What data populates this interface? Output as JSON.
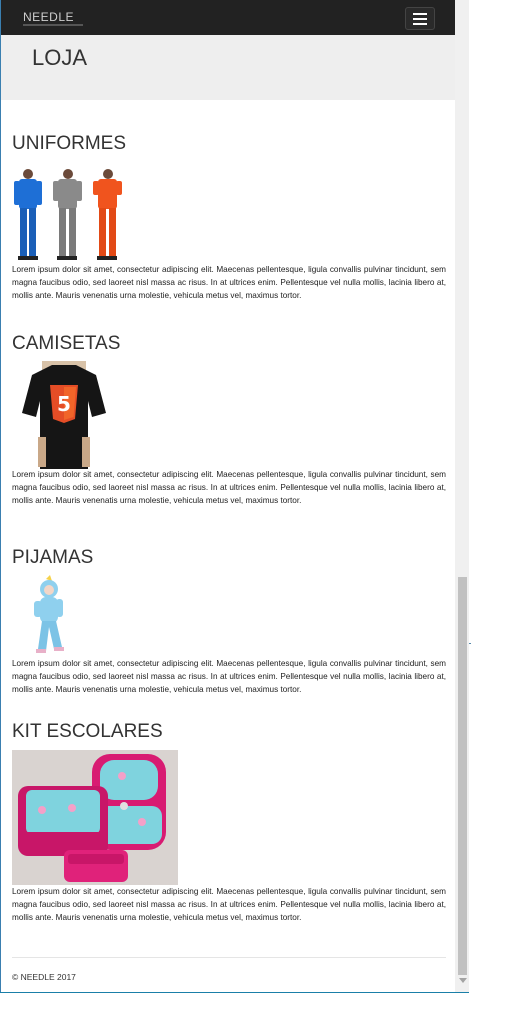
{
  "navbar": {
    "brand": "NEEDLE"
  },
  "hero": {
    "title": "LOJA"
  },
  "sections": [
    {
      "title": "UNIFORMES",
      "image_icon": "uniforms-image",
      "text": "Lorem ipsum dolor sit amet, consectetur adipiscing elit. Maecenas pellentesque, ligula convallis pulvinar tincidunt, sem magna faucibus odio, sed laoreet nisl massa ac risus. In at ultrices enim. Pellentesque vel nulla mollis, lacinia libero at, mollis ante. Mauris venenatis urna molestie, vehicula metus vel, maximus tortor."
    },
    {
      "title": "CAMISETAS",
      "image_icon": "tshirt-image",
      "text": "Lorem ipsum dolor sit amet, consectetur adipiscing elit. Maecenas pellentesque, ligula convallis pulvinar tincidunt, sem magna faucibus odio, sed laoreet nisl massa ac risus. In at ultrices enim. Pellentesque vel nulla mollis, lacinia libero at, mollis ante. Mauris venenatis urna molestie, vehicula metus vel, maximus tortor."
    },
    {
      "title": "PIJAMAS",
      "image_icon": "pajama-image",
      "text": "Lorem ipsum dolor sit amet, consectetur adipiscing elit. Maecenas pellentesque, ligula convallis pulvinar tincidunt, sem magna faucibus odio, sed laoreet nisl massa ac risus. In at ultrices enim. Pellentesque vel nulla mollis, lacinia libero at, mollis ante. Mauris venenatis urna molestie, vehicula metus vel, maximus tortor."
    },
    {
      "title": "KIT ESCOLARES",
      "image_icon": "school-kit-image",
      "text": "Lorem ipsum dolor sit amet, consectetur adipiscing elit. Maecenas pellentesque, ligula convallis pulvinar tincidunt, sem magna faucibus odio, sed laoreet nisl massa ac risus. In at ultrices enim. Pellentesque vel nulla mollis, lacinia libero at, mollis ante. Mauris venenatis urna molestie, vehicula metus vel, maximus tortor."
    }
  ],
  "footer": {
    "text": "© NEEDLE 2017"
  },
  "colors": {
    "navbar": "#222222",
    "hero": "#eeeeee",
    "uniform_blue": "#1e6fd6",
    "uniform_gray": "#8a8a8a",
    "uniform_orange": "#f0541e",
    "html5_orange": "#e44d26",
    "kit_pink": "#d81b72",
    "kit_teal": "#7fd3de"
  }
}
